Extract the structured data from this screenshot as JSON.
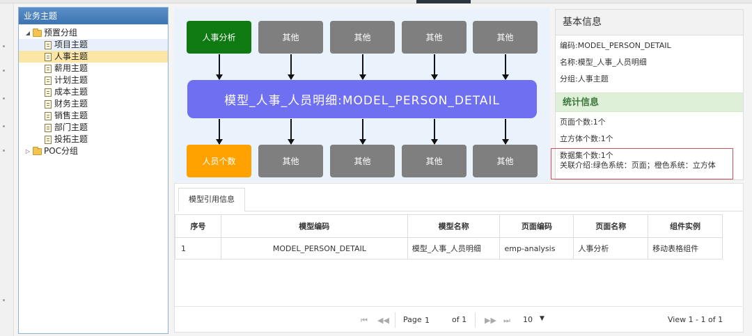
{
  "tree": {
    "title": "业务主题",
    "nodes": [
      {
        "label": "预置分组"
      },
      {
        "label": "项目主题"
      },
      {
        "label": "人事主题"
      },
      {
        "label": "薪用主题"
      },
      {
        "label": "计划主题"
      },
      {
        "label": "成本主题"
      },
      {
        "label": "财务主题"
      },
      {
        "label": "销售主题"
      },
      {
        "label": "部门主题"
      },
      {
        "label": "投拓主题"
      },
      {
        "label": "POC分组"
      }
    ]
  },
  "diagram": {
    "top_boxes": [
      "人事分析",
      "其他",
      "其他",
      "其他",
      "其他"
    ],
    "model_label": "模型_人事_人员明细:MODEL_PERSON_DETAIL",
    "bottom_boxes": [
      "人员个数",
      "其他",
      "其他",
      "其他",
      "其他"
    ],
    "colors": {
      "highlight_top": "#0f7a12",
      "highlight_bottom": "#ffa200",
      "model": "#6f6ff2",
      "other": "#7f7f7f"
    }
  },
  "info": {
    "basic_title": "基本信息",
    "code": "编码:MODEL_PERSON_DETAIL",
    "name": "名称:模型_人事_人员明细",
    "group": "分组:人事主题",
    "stat_title": "统计信息",
    "page_count": "页面个数:1个",
    "cube_count": "立方体个数:1个",
    "dataset_count": "数据集个数:1个",
    "relation": "关联介绍:绿色系统：页面；橙色系统：立方体"
  },
  "refs": {
    "tab_label": "模型引用信息",
    "columns": [
      "序号",
      "模型编码",
      "模型名称",
      "页面编码",
      "页面名称",
      "组件实例"
    ],
    "rows": [
      [
        "1",
        "MODEL_PERSON_DETAIL",
        "模型_人事_人员明细",
        "emp-analysis",
        "人事分析",
        "移动表格组件"
      ]
    ]
  },
  "pager": {
    "page_label": "Page",
    "page_value": "1",
    "of_label": "of 1",
    "page_size": "10",
    "summary": "View 1 - 1 of 1"
  }
}
